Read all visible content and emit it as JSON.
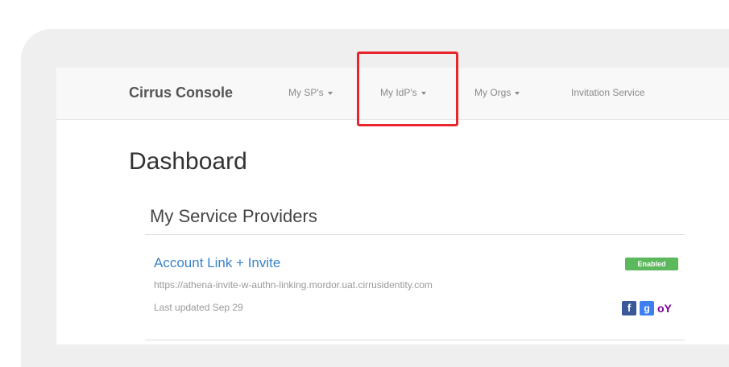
{
  "navbar": {
    "brand": "Cirrus Console",
    "items": [
      {
        "label": "My SP's",
        "dropdown": true
      },
      {
        "label": "My IdP's",
        "dropdown": true
      },
      {
        "label": "My Orgs",
        "dropdown": true
      },
      {
        "label": "Invitation Service",
        "dropdown": false
      }
    ]
  },
  "page": {
    "title": "Dashboard"
  },
  "panel": {
    "heading": "My Service Providers",
    "entries": [
      {
        "name": "Account Link + Invite",
        "url": "https://athena-invite-w-authn-linking.mordor.uat.cirrusidentity.com",
        "updated": "Last updated Sep 29",
        "status": "Enabled",
        "social_icons": [
          {
            "icon": "facebook-icon",
            "glyph": "f"
          },
          {
            "icon": "google-plus-icon",
            "glyph": "g"
          },
          {
            "icon": "yahoo-icon",
            "glyph": "oY"
          }
        ]
      }
    ]
  },
  "colors": {
    "highlight": "#e8242c",
    "link": "#3a84c9",
    "badge": "#5cb85c"
  }
}
